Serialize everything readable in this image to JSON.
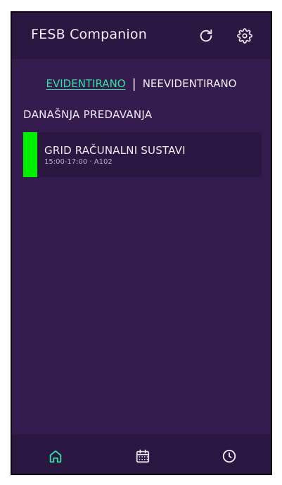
{
  "header": {
    "title": "FESB Companion",
    "refresh_icon": "refresh-icon",
    "settings_icon": "gear-icon"
  },
  "tabs": [
    {
      "label": "EVIDENTIRANO",
      "active": true
    },
    {
      "label": "NEEVIDENTIRANO",
      "active": false
    }
  ],
  "tab_separator": "|",
  "section": {
    "title": "DANAŠNJA PREDAVANJA"
  },
  "lectures": [
    {
      "name": "GRID RAČUNALNI SUSTAVI",
      "meta": "15:00-17:00 · A102",
      "color": "#00f000"
    }
  ],
  "bottom_nav": [
    {
      "icon": "home-icon",
      "active": true
    },
    {
      "icon": "calendar-icon",
      "active": false
    },
    {
      "icon": "clock-icon",
      "active": false
    }
  ],
  "colors": {
    "background": "#341c4f",
    "bar": "#2a1742",
    "accent": "#35e0a1",
    "text": "#f1ecf6"
  }
}
